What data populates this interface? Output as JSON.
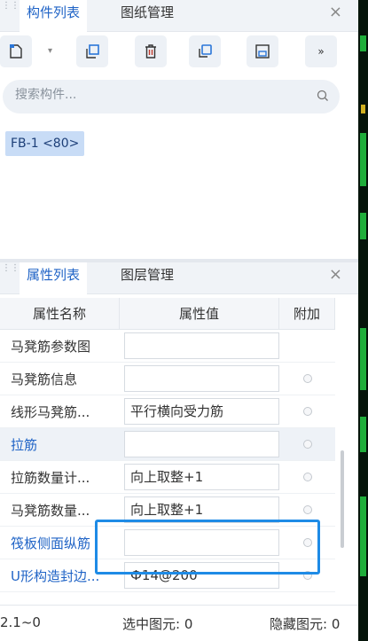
{
  "component_panel": {
    "tabs": [
      {
        "label": "构件列表",
        "active": true
      },
      {
        "label": "图纸管理",
        "active": false
      }
    ],
    "close": "×",
    "toolbar": {
      "more": "»"
    },
    "search": {
      "placeholder": "搜索构件..."
    },
    "items": [
      {
        "label": "FB-1 <80>",
        "selected": true
      }
    ]
  },
  "property_panel": {
    "tabs": [
      {
        "label": "属性列表",
        "active": true
      },
      {
        "label": "图层管理",
        "active": false
      }
    ],
    "close": "×",
    "columns": [
      "属性名称",
      "属性值",
      "附加"
    ],
    "rows": [
      {
        "name": "马凳筋参数图",
        "value": "",
        "link": false,
        "has_dot": false
      },
      {
        "name": "马凳筋信息",
        "value": "",
        "link": false,
        "has_dot": true
      },
      {
        "name": "线形马凳筋...",
        "value": "平行横向受力筋",
        "link": false,
        "has_dot": true
      },
      {
        "name": "拉筋",
        "value": "",
        "link": true,
        "has_dot": true
      },
      {
        "name": "拉筋数量计...",
        "value": "向上取整+1",
        "link": false,
        "has_dot": true
      },
      {
        "name": "马凳筋数量...",
        "value": "向上取整+1",
        "link": false,
        "has_dot": true
      },
      {
        "name": "筏板侧面纵筋",
        "value": "",
        "link": true,
        "has_dot": true
      },
      {
        "name": "U形构造封边...",
        "value": "Ф14@200",
        "link": true,
        "has_dot": true
      }
    ]
  },
  "statusbar": {
    "left": "2.1~0",
    "selected": "选中图元: 0",
    "hidden": "隐藏图元: 0"
  },
  "colors": {
    "accent": "#1f63c6",
    "highlight_border": "#1e8be6",
    "selected_item_bg": "#c8dcf6"
  }
}
